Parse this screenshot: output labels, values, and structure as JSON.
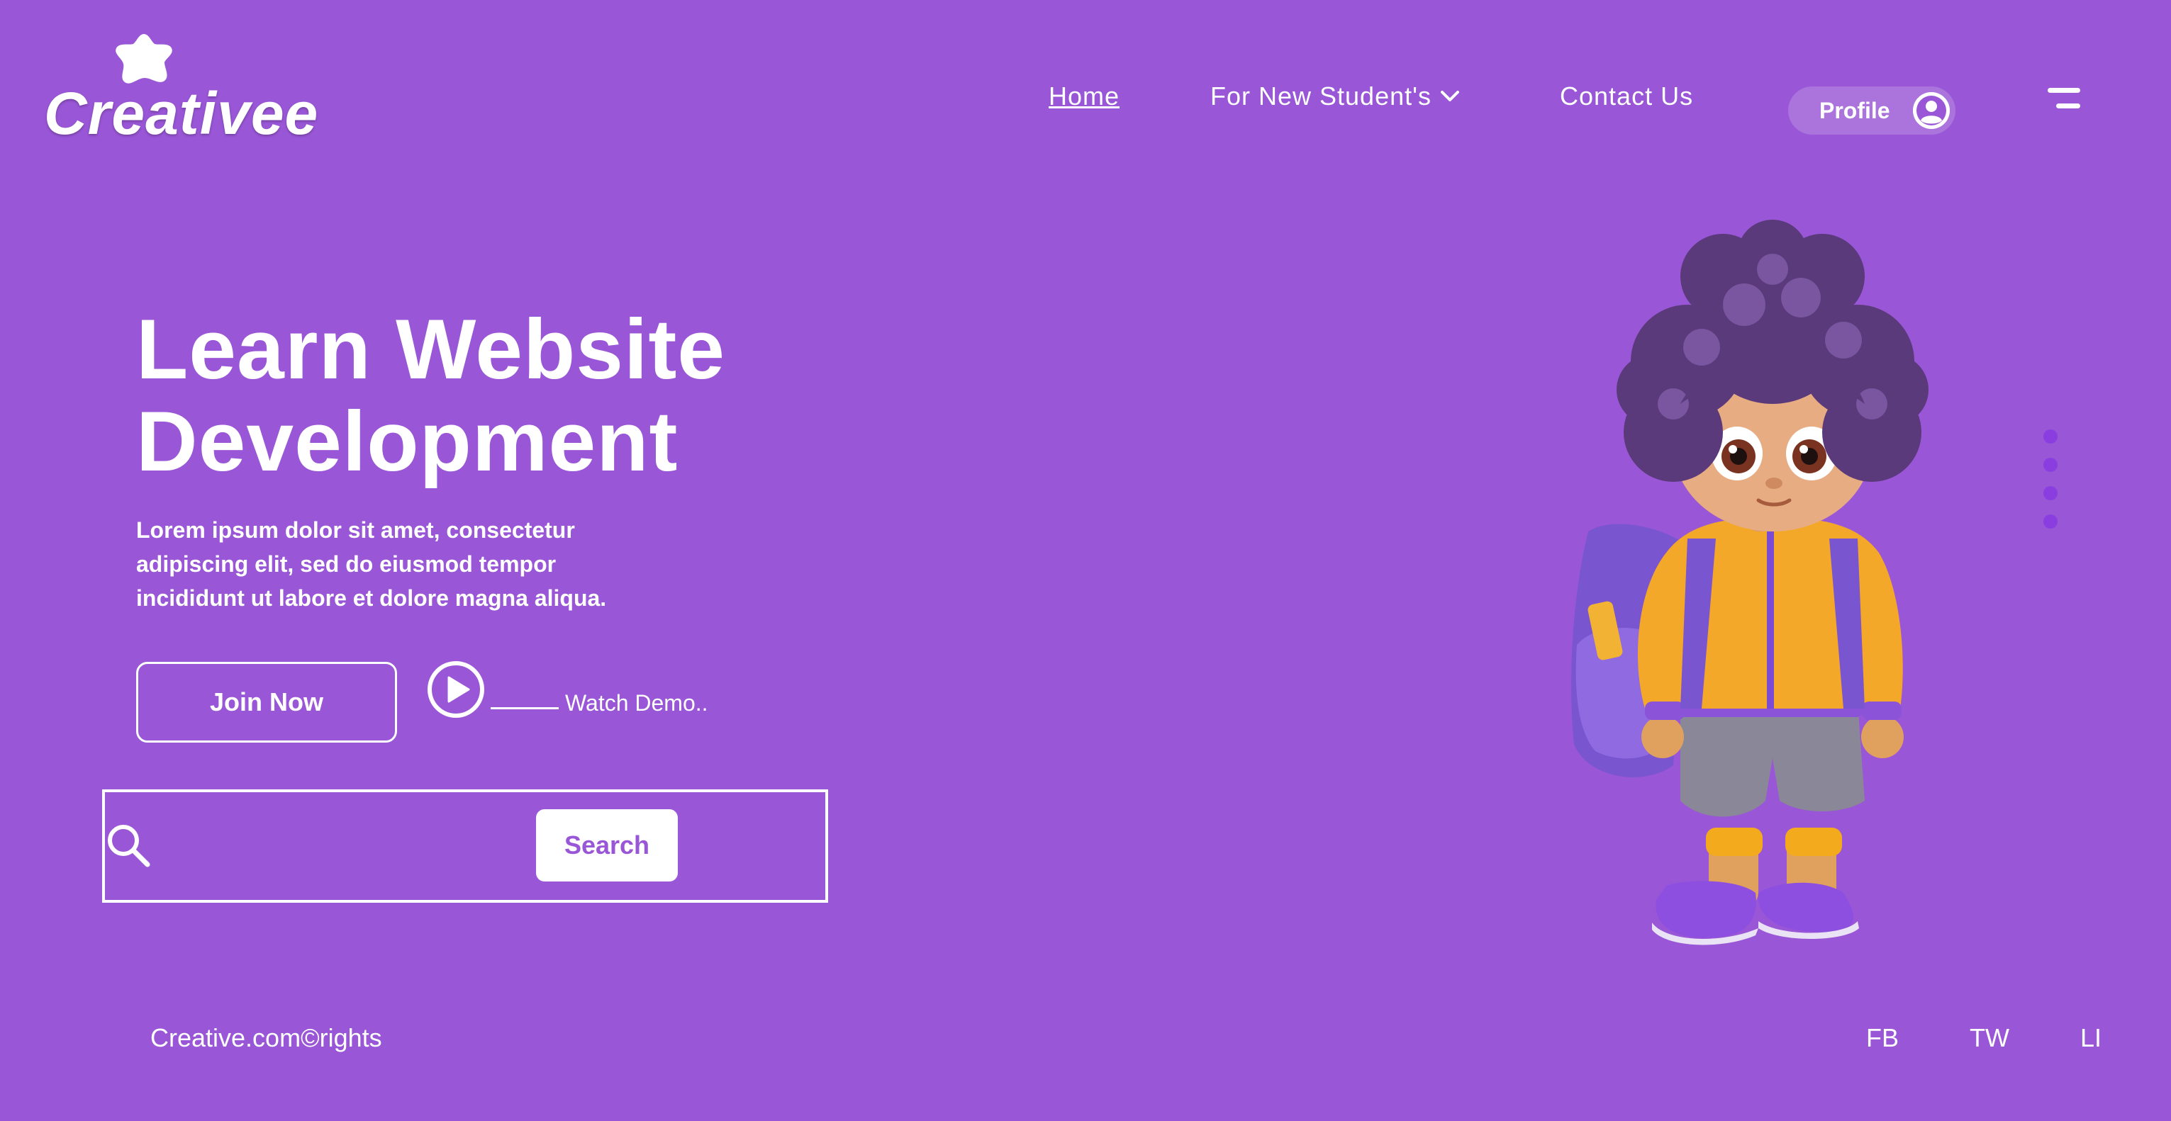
{
  "brand": {
    "name": "Creativee",
    "logo_icon": "star-blob-icon"
  },
  "nav": {
    "items": [
      {
        "label": "Home",
        "active": true
      },
      {
        "label": "For New Student's",
        "dropdown": true
      },
      {
        "label": "Contact Us"
      }
    ],
    "profile_label": "Profile",
    "menu_icon": "hamburger-icon"
  },
  "hero": {
    "title_line1": "Learn Website",
    "title_line2": "Development",
    "description": "Lorem ipsum dolor sit amet, consectetur adipiscing elit, sed do eiusmod tempor incididunt ut labore et dolore magna aliqua.",
    "join_label": "Join Now",
    "watch_label": "Watch Demo.."
  },
  "search": {
    "value": "",
    "placeholder": "",
    "button_label": "Search"
  },
  "footer": {
    "copyright": "Creative.com©rights",
    "social": [
      "FB",
      "TW",
      "LI"
    ]
  },
  "colors": {
    "background": "#9956d6",
    "accent_dot": "#8a3ee0",
    "text": "#ffffff"
  }
}
